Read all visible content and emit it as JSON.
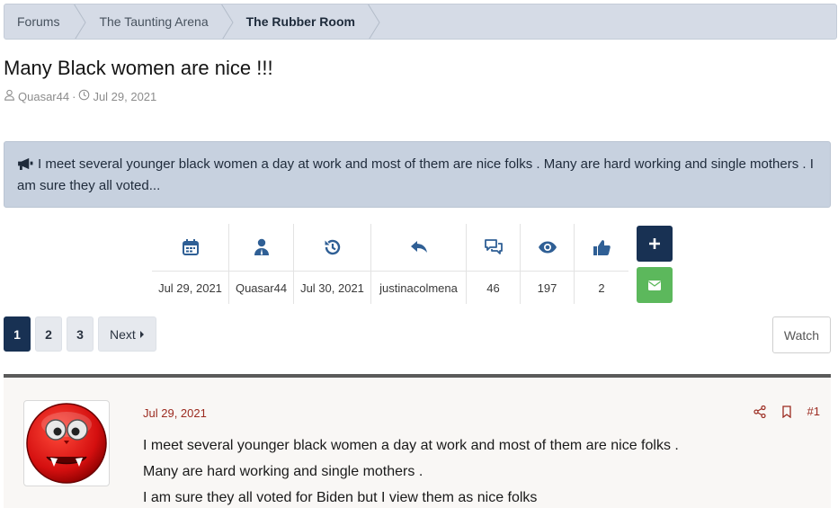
{
  "breadcrumb": {
    "items": [
      "Forums",
      "The Taunting Arena",
      "The Rubber Room"
    ]
  },
  "thread": {
    "title": "Many Black women are nice !!!",
    "author": "Quasar44",
    "separator": "·",
    "date": "Jul 29, 2021"
  },
  "notice": {
    "icon": "megaphone-icon",
    "text": "I meet several younger black women a day at work and most of them are nice folks . Many are hard working and single mothers . I am sure they all voted..."
  },
  "stats": [
    {
      "icon": "calendar-icon",
      "value": "Jul 29, 2021"
    },
    {
      "icon": "user-icon",
      "value": "Quasar44"
    },
    {
      "icon": "history-icon",
      "value": "Jul 30, 2021"
    },
    {
      "icon": "reply-icon",
      "value": "justinacolmena"
    },
    {
      "icon": "comments-icon",
      "value": "46"
    },
    {
      "icon": "eye-icon",
      "value": "197"
    },
    {
      "icon": "thumbs-up-icon",
      "value": "2"
    }
  ],
  "actions": {
    "plus_icon": "plus-icon",
    "mail_icon": "envelope-icon"
  },
  "pagination": {
    "pages": [
      "1",
      "2",
      "3"
    ],
    "current": "1",
    "next_label": "Next"
  },
  "watch_label": "Watch",
  "post": {
    "date": "Jul 29, 2021",
    "number": "#1",
    "lines": [
      "I meet several younger black women a day at work and most of them are nice folks .",
      "Many are hard working and single mothers .",
      "I am sure they all voted for Biden but I view them as nice folks"
    ]
  },
  "colors": {
    "accent_dark": "#183153",
    "accent_green": "#5cb85c",
    "post_link": "#9b2a1f",
    "icon_blue": "#2f5f95"
  }
}
